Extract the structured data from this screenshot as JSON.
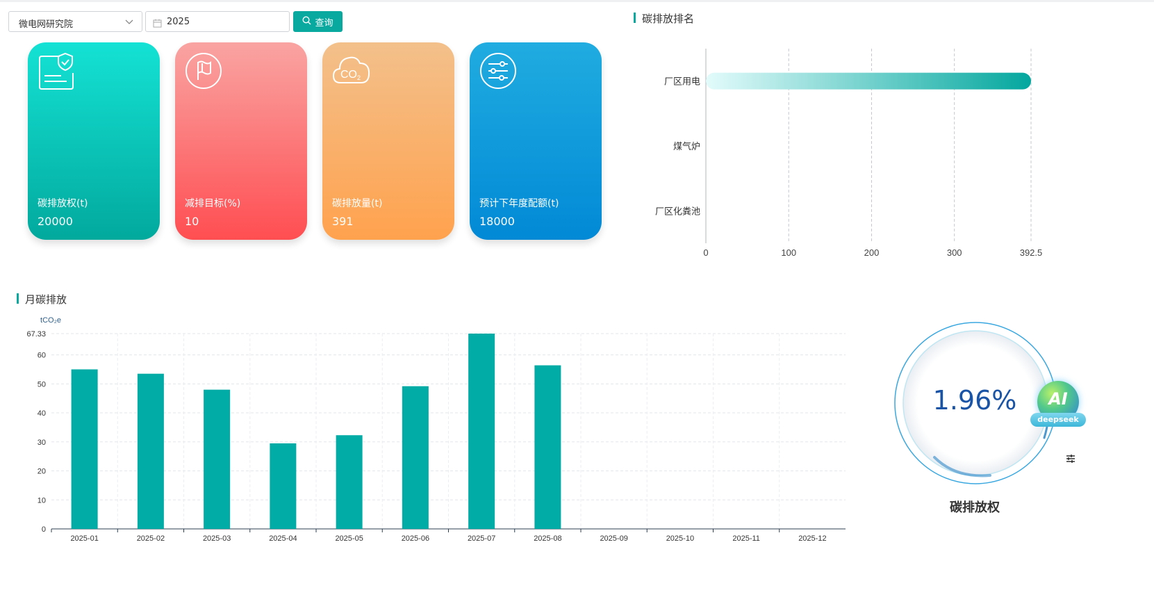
{
  "filters": {
    "org_value": "微电网研究院",
    "year_value": "2025",
    "query_label": "查询"
  },
  "cards": [
    {
      "label": "碳排放权(t)",
      "value": "20000",
      "icon": "document-shield-icon"
    },
    {
      "label": "减排目标(%)",
      "value": "10",
      "icon": "flag-icon"
    },
    {
      "label": "碳排放量(t)",
      "value": "391",
      "icon": "co2-cloud-icon"
    },
    {
      "label": "预计下年度配额(t)",
      "value": "18000",
      "icon": "sliders-icon"
    }
  ],
  "ranking": {
    "title": "碳排放排名"
  },
  "monthly": {
    "title": "月碳排放"
  },
  "gauge": {
    "value_text": "1.96%",
    "value": 1.96,
    "title": "碳排放权"
  },
  "ai_badge": {
    "text": "AI",
    "brand": "deepseek"
  },
  "colors": {
    "accent": "#0aa9a0",
    "card1": "#02a99d",
    "card2": "#ff4e52",
    "card3": "#ffa24e",
    "card4": "#0289d6",
    "gauge_text": "#1a54a6"
  },
  "chart_data": [
    {
      "type": "bar",
      "orientation": "horizontal",
      "categories": [
        "厂区用电",
        "煤气炉",
        "厂区化粪池"
      ],
      "values": [
        392.5,
        0,
        0
      ],
      "xlim": [
        0,
        392.5
      ],
      "x_ticks": [
        "0",
        "100",
        "200",
        "300",
        "392.5"
      ],
      "grid": "vertical-dashed"
    },
    {
      "type": "bar",
      "categories": [
        "2025-01",
        "2025-02",
        "2025-03",
        "2025-04",
        "2025-05",
        "2025-06",
        "2025-07",
        "2025-08",
        "2025-09",
        "2025-10",
        "2025-11",
        "2025-12"
      ],
      "values": [
        55,
        53.5,
        48,
        29.5,
        32.3,
        49.2,
        67.33,
        56.4,
        0,
        0,
        0,
        0
      ],
      "ylabel": "tCO₂e",
      "ylim": [
        0,
        67.33
      ],
      "y_ticks": [
        "0",
        "10",
        "20",
        "30",
        "40",
        "50",
        "60",
        "67.33"
      ],
      "grid": "dashed"
    }
  ]
}
